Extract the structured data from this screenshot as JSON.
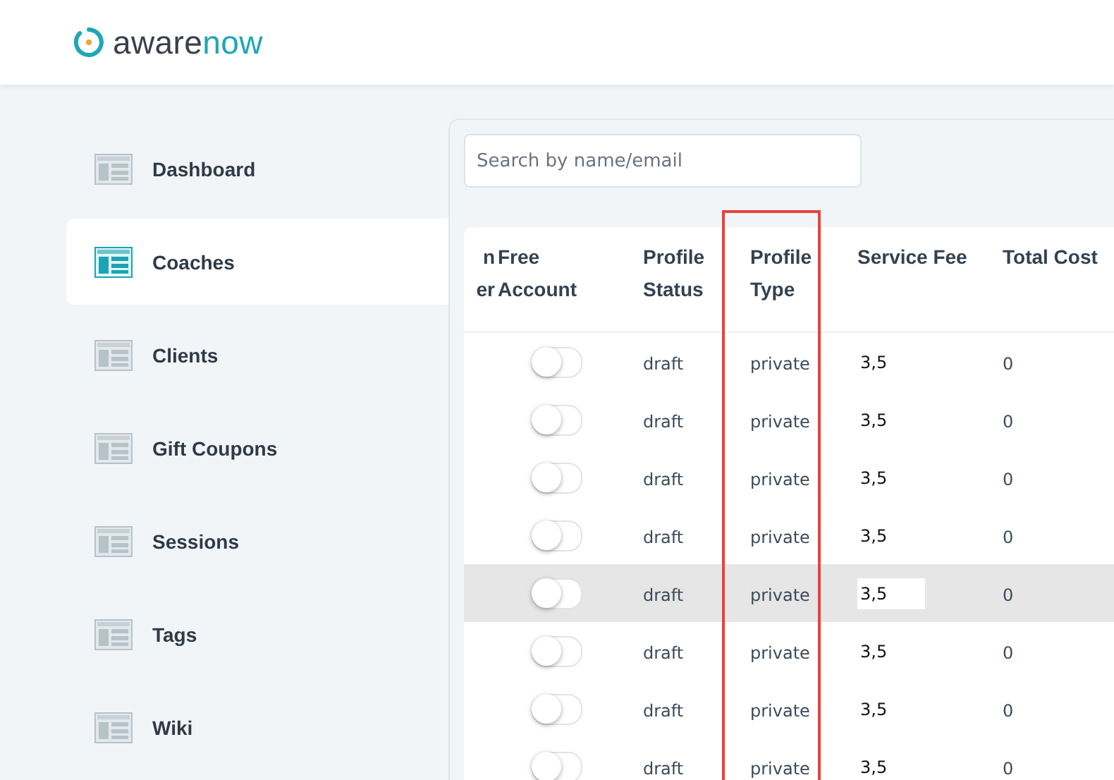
{
  "logo": {
    "dark": "aware",
    "accent": "now"
  },
  "sidebar": {
    "items": [
      {
        "label": "Dashboard",
        "selected": false
      },
      {
        "label": "Coaches",
        "selected": true
      },
      {
        "label": "Clients",
        "selected": false
      },
      {
        "label": "Gift Coupons",
        "selected": false
      },
      {
        "label": "Sessions",
        "selected": false
      },
      {
        "label": "Tags",
        "selected": false
      },
      {
        "label": "Wiki",
        "selected": false
      }
    ]
  },
  "search": {
    "placeholder": "Search by name/email"
  },
  "table": {
    "columns": [
      {
        "lines": [
          "n",
          "er"
        ],
        "annotated": false
      },
      {
        "lines": [
          "Free",
          "Account"
        ],
        "annotated": false
      },
      {
        "lines": [
          "Profile",
          "Status"
        ],
        "annotated": false
      },
      {
        "lines": [
          "Profile",
          "Type"
        ],
        "annotated": true
      },
      {
        "lines": [
          "Service Fee"
        ],
        "annotated": false
      },
      {
        "lines": [
          "Total Cost"
        ],
        "annotated": false
      }
    ],
    "rows": [
      {
        "free_account": false,
        "status": "draft",
        "type": "private",
        "fee": "3,5",
        "total": "0",
        "selected": false
      },
      {
        "free_account": false,
        "status": "draft",
        "type": "private",
        "fee": "3,5",
        "total": "0",
        "selected": false
      },
      {
        "free_account": false,
        "status": "draft",
        "type": "private",
        "fee": "3,5",
        "total": "0",
        "selected": false
      },
      {
        "free_account": false,
        "status": "draft",
        "type": "private",
        "fee": "3,5",
        "total": "0",
        "selected": false
      },
      {
        "free_account": false,
        "status": "draft",
        "type": "private",
        "fee": "3,5",
        "total": "0",
        "selected": true
      },
      {
        "free_account": false,
        "status": "draft",
        "type": "private",
        "fee": "3,5",
        "total": "0",
        "selected": false
      },
      {
        "free_account": false,
        "status": "draft",
        "type": "private",
        "fee": "3,5",
        "total": "0",
        "selected": false
      },
      {
        "free_account": false,
        "status": "draft",
        "type": "private",
        "fee": "3,5",
        "total": "0",
        "selected": false
      }
    ]
  }
}
